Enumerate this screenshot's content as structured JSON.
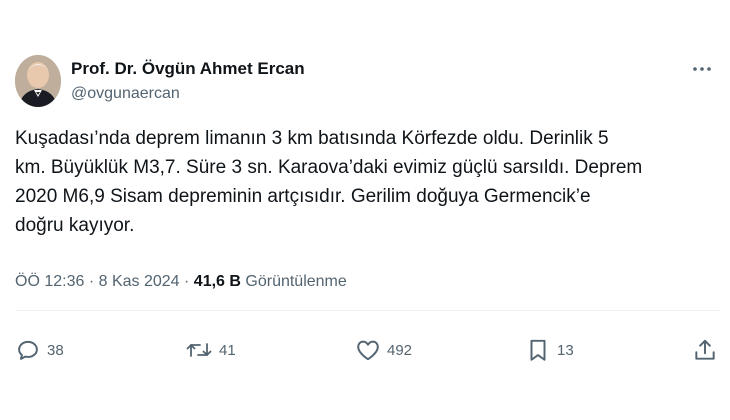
{
  "author": {
    "name": "Prof. Dr. Övgün Ahmet Ercan",
    "handle": "@ovgunaercan"
  },
  "tweet": {
    "text": "Kuşadası’nda deprem limanın 3 km batısında Körfezde oldu. Derinlik 5\nkm. Büyüklük M3,7. Süre 3 sn. Karaova’daki evimiz güçlü sarsıldı. Deprem\n2020 M6,9 Sisam depreminin artçısıdır. Gerilim doğuya Germencik’e\ndoğru kayıyor.",
    "time": "ÖÖ 12:36",
    "date": "8 Kas 2024",
    "sep1": "·",
    "sep2": "·",
    "views_count": "41,6 B",
    "views_label": "Görüntülenme"
  },
  "actions": {
    "reply_count": "38",
    "retweet_count": "41",
    "like_count": "492",
    "bookmark_count": "13"
  },
  "icons": {
    "more": "more-horizontal-icon",
    "reply": "reply-icon",
    "retweet": "retweet-icon",
    "like": "heart-icon",
    "bookmark": "bookmark-icon",
    "share": "share-icon"
  },
  "colors": {
    "text": "#0f1419",
    "secondary": "#536471",
    "divider": "#eff3f4"
  }
}
